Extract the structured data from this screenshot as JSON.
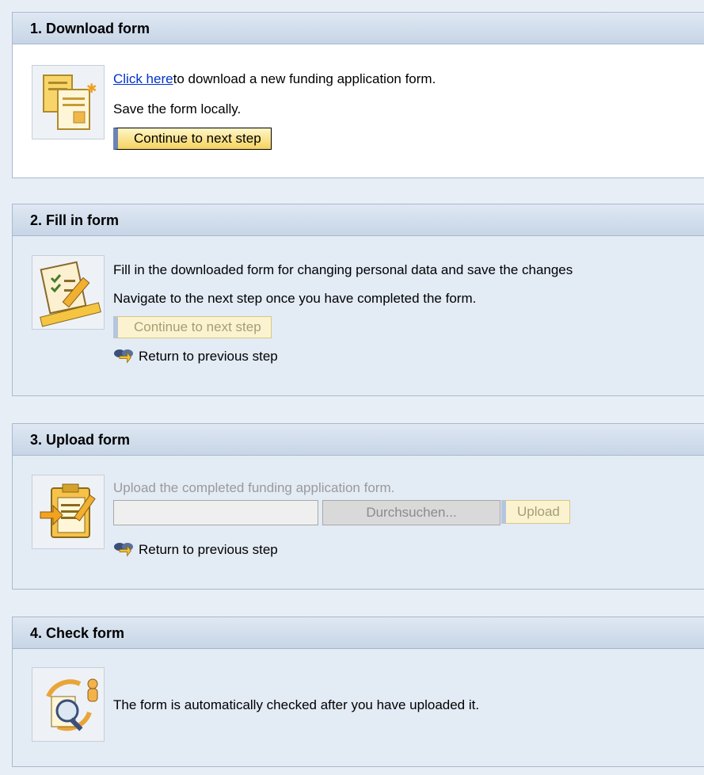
{
  "steps": {
    "download": {
      "title": "1. Download form",
      "link_text": "Click here",
      "link_suffix": "to download a new funding application form.",
      "save_text": "Save the form locally.",
      "continue_label": "Continue to next step"
    },
    "fill": {
      "title": "2. Fill in form",
      "line1": "Fill in the downloaded form for changing personal data and save the changes",
      "line2": "Navigate to the next step once you have completed the form.",
      "continue_label": "Continue to next step",
      "return_label": "Return to previous step"
    },
    "upload": {
      "title": "3. Upload form",
      "instruction": "Upload the completed funding application form.",
      "file_value": "",
      "browse_label": "Durchsuchen...",
      "upload_label": "Upload",
      "return_label": "Return to previous step"
    },
    "check": {
      "title": "4. Check form",
      "text": "The form is automatically checked after you have uploaded it."
    }
  },
  "icons": {
    "download": "document-download-icon",
    "fill": "form-edit-ruler-icon",
    "upload": "clipboard-upload-icon",
    "check": "form-check-magnifier-icon",
    "return": "return-arrow-icon"
  },
  "colors": {
    "primary_button": "#f4d35e",
    "link": "#0033cc",
    "header": "#c7d5e6",
    "disabled_text": "#9a9a9a"
  }
}
